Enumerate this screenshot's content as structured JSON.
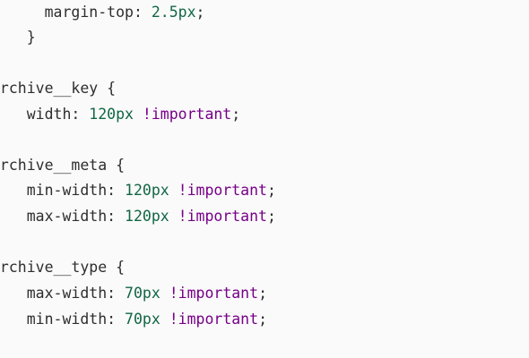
{
  "code": {
    "lines": [
      {
        "indent": "      ",
        "prop": "margin-top",
        "colon": ": ",
        "value": "2.5px",
        "imp": "",
        "semi": ";"
      },
      {
        "indent": "    ",
        "text": "}"
      },
      {
        "indent": "",
        "text": ""
      },
      {
        "indent": "",
        "text": "archive__key {"
      },
      {
        "indent": "    ",
        "prop": "width",
        "colon": ": ",
        "value": "120px",
        "imp": " !important",
        "semi": ";"
      },
      {
        "indent": "",
        "text": ""
      },
      {
        "indent": "",
        "text": "archive__meta {"
      },
      {
        "indent": "    ",
        "prop": "min-width",
        "colon": ": ",
        "value": "120px",
        "imp": " !important",
        "semi": ";"
      },
      {
        "indent": "    ",
        "prop": "max-width",
        "colon": ": ",
        "value": "120px",
        "imp": " !important",
        "semi": ";"
      },
      {
        "indent": "",
        "text": ""
      },
      {
        "indent": "",
        "text": "archive__type {"
      },
      {
        "indent": "    ",
        "prop": "max-width",
        "colon": ": ",
        "value": "70px",
        "imp": " !important",
        "semi": ";"
      },
      {
        "indent": "    ",
        "prop": "min-width",
        "colon": ": ",
        "value": "70px",
        "imp": " !important",
        "semi": ";"
      }
    ]
  },
  "colors": {
    "background": "#fafafa",
    "text": "#2e2e2e",
    "number": "#116644",
    "keyword": "#770088"
  }
}
